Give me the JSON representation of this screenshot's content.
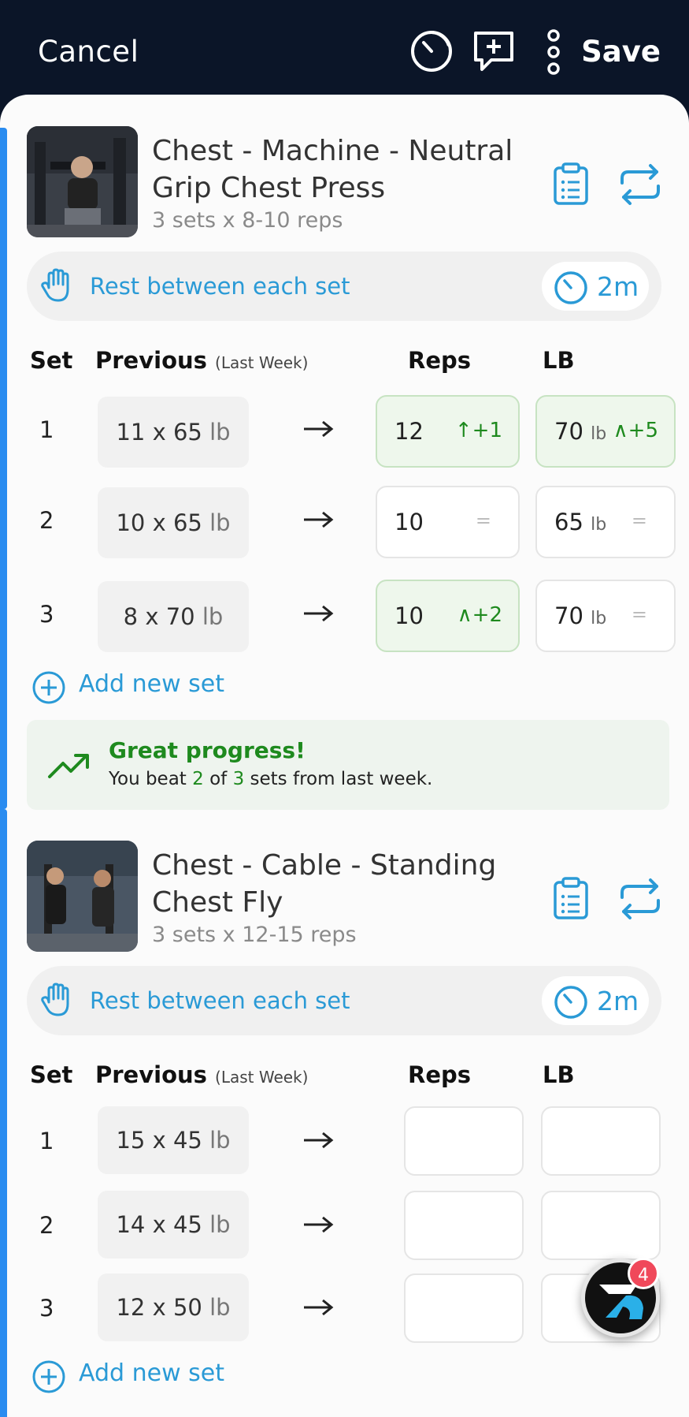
{
  "topbar": {
    "cancel_label": "Cancel",
    "save_label": "Save",
    "icons": [
      "timer-icon",
      "add-comment-icon",
      "more-vertical-icon"
    ]
  },
  "colors": {
    "header_bg": "#0b1528",
    "accent_blue": "#2a9ad6",
    "progress_green": "#1e8a1e",
    "side_bar_blue": "#2a8cf0"
  },
  "exercises": [
    {
      "title": "Chest - Machine - Neutral Grip Chest Press",
      "title_line1": "Chest - Machine - Neutral",
      "title_line2": "Grip Chest Press",
      "subtitle": "3 sets x 8-10 reps",
      "rest_label": "Rest between each set",
      "rest_time": "2m",
      "columns": {
        "set": "Set",
        "previous": "Previous",
        "previous_note": "(Last Week)",
        "reps": "Reps",
        "weight": "LB"
      },
      "sets": [
        {
          "num": "1",
          "prev": "11 x 65",
          "prev_unit": "lb",
          "reps": "12",
          "reps_delta": "+1",
          "weight": "70",
          "weight_unit": "lb",
          "weight_delta": "+5"
        },
        {
          "num": "2",
          "prev": "10 x 65",
          "prev_unit": "lb",
          "reps": "10",
          "reps_delta": "=",
          "weight": "65",
          "weight_unit": "lb",
          "weight_delta": "="
        },
        {
          "num": "3",
          "prev": "8 x 70",
          "prev_unit": "lb",
          "reps": "10",
          "reps_delta": "+2",
          "weight": "70",
          "weight_unit": "lb",
          "weight_delta": "="
        }
      ],
      "add_set_label": "Add new set",
      "progress": {
        "title": "Great progress!",
        "pre": "You beat",
        "beaten": "2",
        "mid": "of",
        "total": "3",
        "post": "sets from last week."
      }
    },
    {
      "title": "Chest - Cable - Standing Chest Fly",
      "title_line1": "Chest - Cable - Standing",
      "title_line2": "Chest Fly",
      "subtitle": "3 sets x 12-15 reps",
      "rest_label": "Rest between each set",
      "rest_time": "2m",
      "columns": {
        "set": "Set",
        "previous": "Previous",
        "previous_note": "(Last Week)",
        "reps": "Reps",
        "weight": "LB"
      },
      "sets": [
        {
          "num": "1",
          "prev": "15 x 45",
          "prev_unit": "lb",
          "reps": "",
          "weight": ""
        },
        {
          "num": "2",
          "prev": "14 x 45",
          "prev_unit": "lb",
          "reps": "",
          "weight": ""
        },
        {
          "num": "3",
          "prev": "12 x 50",
          "prev_unit": "lb",
          "reps": "",
          "weight": ""
        }
      ],
      "add_set_label": "Add new set"
    }
  ],
  "fab": {
    "badge_count": "4"
  }
}
